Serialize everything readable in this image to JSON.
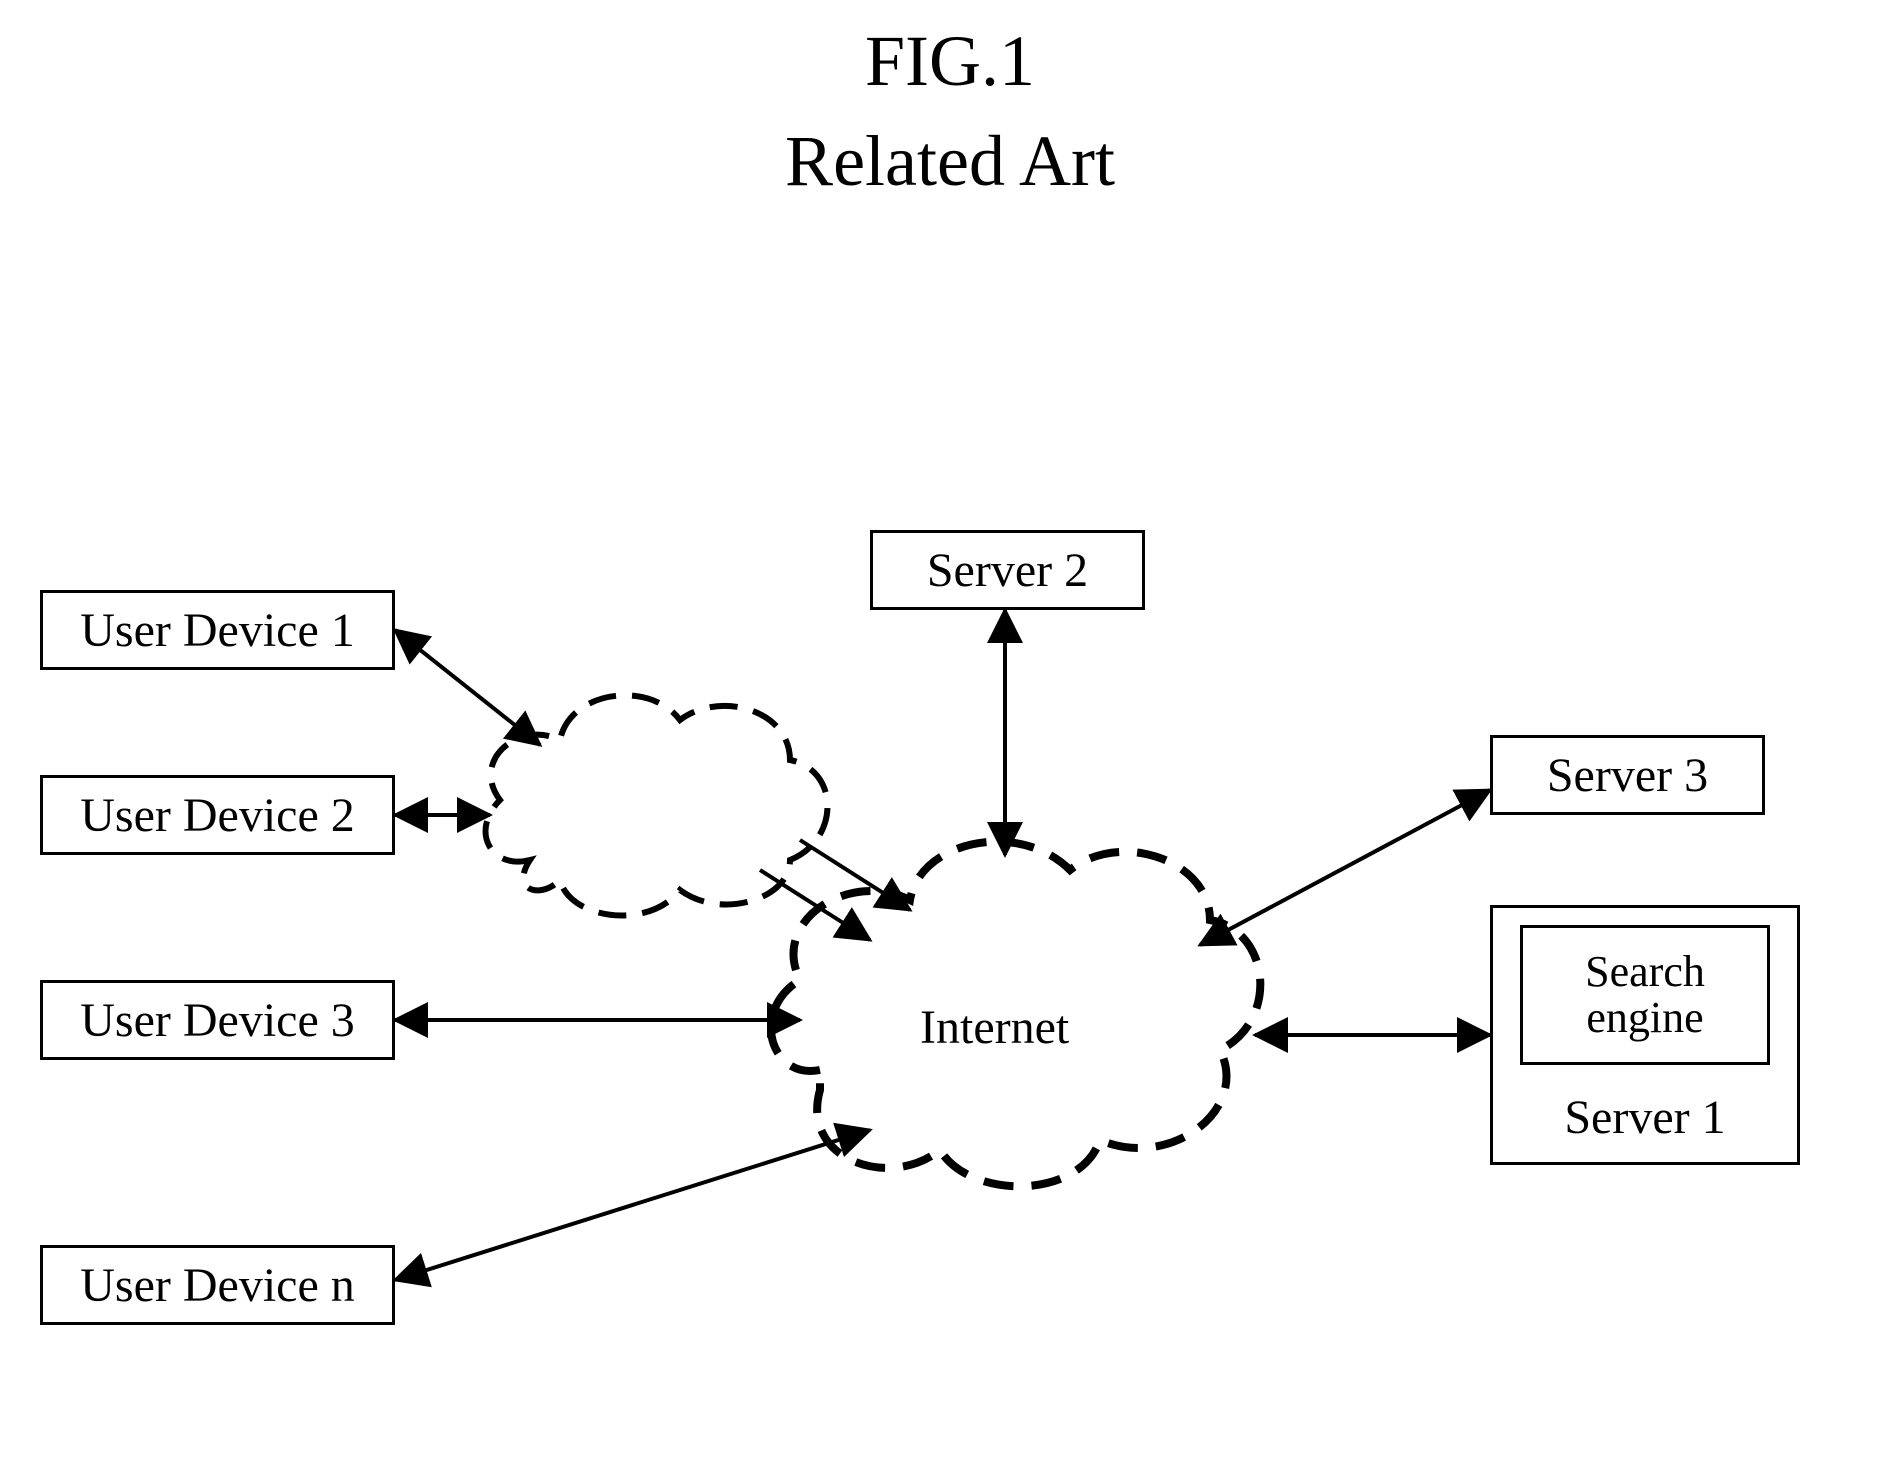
{
  "title": {
    "line1": "FIG.1",
    "line2": "Related Art"
  },
  "devices": {
    "d1": "User Device 1",
    "d2": "User Device 2",
    "d3": "User Device 3",
    "dn": "User Device n"
  },
  "servers": {
    "s1_label": "Server 1",
    "s1_inner": "Search\nengine",
    "s2": "Server 2",
    "s3": "Server 3"
  },
  "cloud": {
    "internet": "Internet"
  }
}
